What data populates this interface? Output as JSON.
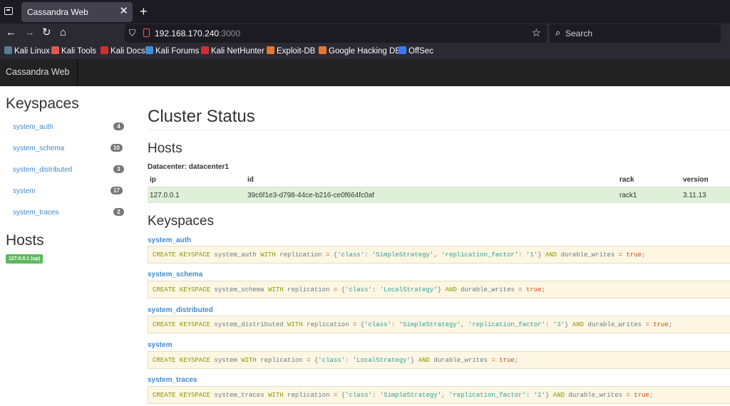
{
  "browser": {
    "tab_title": "Cassandra Web",
    "url_host": "192.168.170.240",
    "url_port": ":3000",
    "search_placeholder": "Search",
    "bookmarks": [
      {
        "label": "Kali Linux",
        "color": "#557c94"
      },
      {
        "label": "Kali Tools",
        "color": "#e05a4b"
      },
      {
        "label": "Kali Docs",
        "color": "#d12f2f"
      },
      {
        "label": "Kali Forums",
        "color": "#3f8fd6"
      },
      {
        "label": "Kali NetHunter",
        "color": "#d12f2f"
      },
      {
        "label": "Exploit-DB",
        "color": "#e8762c"
      },
      {
        "label": "Google Hacking DB",
        "color": "#e8762c"
      },
      {
        "label": "OffSec",
        "color": "#3a78f2"
      }
    ]
  },
  "app": {
    "brand": "Cassandra Web",
    "sidebar": {
      "keyspaces_heading": "Keyspaces",
      "keyspaces": [
        {
          "name": "system_auth",
          "count": "4"
        },
        {
          "name": "system_schema",
          "count": "10"
        },
        {
          "name": "system_distributed",
          "count": "3"
        },
        {
          "name": "system",
          "count": "17"
        },
        {
          "name": "system_traces",
          "count": "2"
        }
      ],
      "hosts_heading": "Hosts",
      "host_label": "127.0.0.1 (up)"
    },
    "main": {
      "title": "Cluster Status",
      "hosts_heading": "Hosts",
      "datacenter": "Datacenter: datacenter1",
      "columns": [
        "ip",
        "id",
        "rack",
        "version"
      ],
      "rows": [
        {
          "ip": "127.0.0.1",
          "id": "39c6f1e3-d798-44ce-b216-ce0f664fc0af",
          "rack": "rack1",
          "version": "3.11.13"
        }
      ],
      "keyspaces_heading": "Keyspaces",
      "keyspaces": [
        {
          "name": "system_auth",
          "cql": {
            "kw1": "CREATE KEYSPACE",
            "ident": " system_auth ",
            "kw2": "WITH",
            "mid": " replication ",
            "eq": "=",
            "map_open": " {",
            "s1": "'class'",
            "c1": ": ",
            "s2": "'SimpleStrategy'",
            "c2": ", ",
            "s3": "'replication_factor'",
            "c3": ": ",
            "s4": "'1'",
            "map_close": "} ",
            "kw3": "AND",
            "tail": " durable_writes ",
            "eq2": "=",
            "sp": " ",
            "val": "true",
            "semi": ";"
          }
        },
        {
          "name": "system_schema",
          "cql": {
            "kw1": "CREATE KEYSPACE",
            "ident": " system_schema ",
            "kw2": "WITH",
            "mid": " replication ",
            "eq": "=",
            "map_open": " {",
            "s1": "'class'",
            "c1": ": ",
            "s2": "'LocalStrategy'",
            "c2": "",
            "s3": "",
            "c3": "",
            "s4": "",
            "map_close": "} ",
            "kw3": "AND",
            "tail": " durable_writes ",
            "eq2": "=",
            "sp": " ",
            "val": "true",
            "semi": ";"
          }
        },
        {
          "name": "system_distributed",
          "cql": {
            "kw1": "CREATE KEYSPACE",
            "ident": " system_distributed ",
            "kw2": "WITH",
            "mid": " replication ",
            "eq": "=",
            "map_open": " {",
            "s1": "'class'",
            "c1": ": ",
            "s2": "'SimpleStrategy'",
            "c2": ", ",
            "s3": "'replication_factor'",
            "c3": ": ",
            "s4": "'3'",
            "map_close": "} ",
            "kw3": "AND",
            "tail": " durable_writes ",
            "eq2": "=",
            "sp": " ",
            "val": "true",
            "semi": ";"
          }
        },
        {
          "name": "system",
          "cql": {
            "kw1": "CREATE KEYSPACE",
            "ident": " system ",
            "kw2": "WITH",
            "mid": " replication ",
            "eq": "=",
            "map_open": " {",
            "s1": "'class'",
            "c1": ": ",
            "s2": "'LocalStrategy'",
            "c2": "",
            "s3": "",
            "c3": "",
            "s4": "",
            "map_close": "} ",
            "kw3": "AND",
            "tail": " durable_writes ",
            "eq2": "=",
            "sp": " ",
            "val": "true",
            "semi": ";"
          }
        },
        {
          "name": "system_traces",
          "cql": {
            "kw1": "CREATE KEYSPACE",
            "ident": " system_traces ",
            "kw2": "WITH",
            "mid": " replication ",
            "eq": "=",
            "map_open": " {",
            "s1": "'class'",
            "c1": ": ",
            "s2": "'SimpleStrategy'",
            "c2": ", ",
            "s3": "'replication_factor'",
            "c3": ": ",
            "s4": "'2'",
            "map_close": "} ",
            "kw3": "AND",
            "tail": " durable_writes ",
            "eq2": "=",
            "sp": " ",
            "val": "true",
            "semi": ";"
          }
        }
      ]
    }
  }
}
